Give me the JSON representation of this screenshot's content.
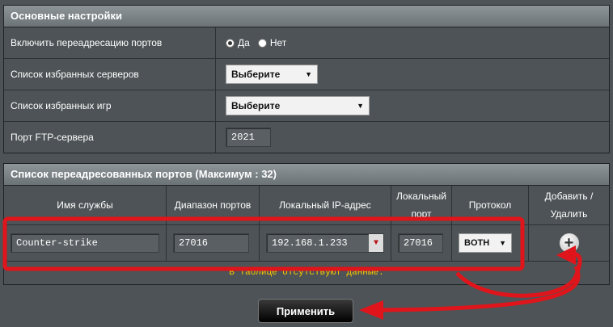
{
  "basic": {
    "title": "Основные настройки",
    "rows": {
      "forward_label": "Включить переадресацию портов",
      "yes": "Да",
      "no": "Нет",
      "servers_label": "Список избранных серверов",
      "servers_value": "Выберите",
      "games_label": "Список избранных игр",
      "games_value": "Выберите",
      "ftp_label": "Порт FTP-сервера",
      "ftp_value": "2021"
    }
  },
  "list": {
    "title": "Список переадресованных портов (Максимум : 32)",
    "columns": {
      "service": "Имя службы",
      "range": "Диапазон портов",
      "ip": "Локальный IP-адрес",
      "lport_1": "Локальный",
      "lport_2": "порт",
      "proto": "Протокол",
      "add_1": "Добавить /",
      "add_2": "Удалить"
    },
    "entry": {
      "service": "Counter-strike",
      "range": "27016",
      "ip": "192.168.1.233",
      "lport": "27016",
      "proto": "BOTH"
    },
    "empty_msg": "В таблице отсутствуют данные."
  },
  "apply_label": "Применить",
  "colors": {
    "annotation": "#e0151b",
    "notice": "#ffcc00"
  },
  "icons": {
    "add": "plus-circle-icon",
    "dropdown": "caret-down-icon"
  }
}
